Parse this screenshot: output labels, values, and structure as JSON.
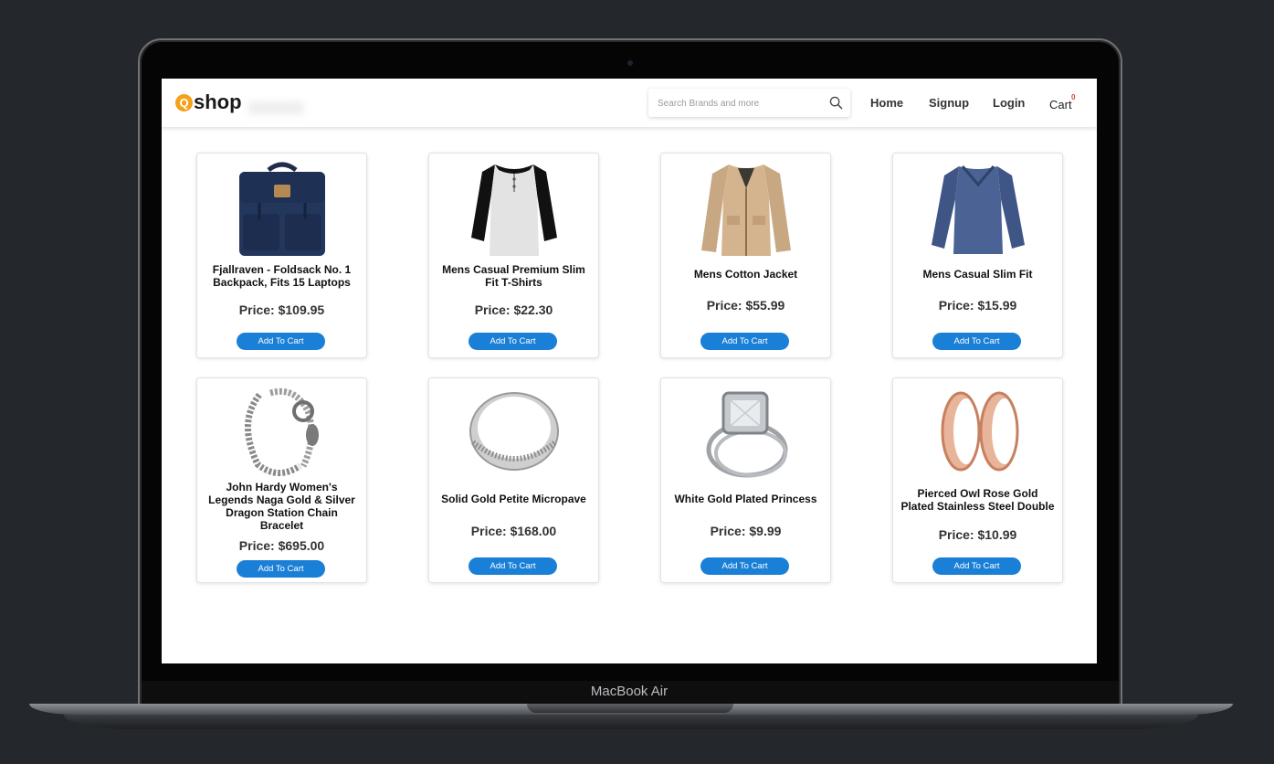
{
  "app": {
    "logo_letter": "Q",
    "logo_text": "shop"
  },
  "search": {
    "placeholder": "Search Brands and more"
  },
  "nav": {
    "home": "Home",
    "signup": "Signup",
    "login": "Login",
    "cart": "Cart",
    "cart_count": "0"
  },
  "device": {
    "label": "MacBook Air"
  },
  "products": [
    {
      "title": "Fjallraven - Foldsack No. 1 Backpack, Fits 15 Laptops",
      "price": "Price: $109.95",
      "button": "Add To Cart",
      "image": "backpack"
    },
    {
      "title": "Mens Casual Premium Slim Fit T-Shirts",
      "price": "Price: $22.30",
      "button": "Add To Cart",
      "image": "raglan-shirt"
    },
    {
      "title": "Mens Cotton Jacket",
      "price": "Price: $55.99",
      "button": "Add To Cart",
      "image": "jacket"
    },
    {
      "title": "Mens Casual Slim Fit",
      "price": "Price: $15.99",
      "button": "Add To Cart",
      "image": "long-sleeve-shirt"
    },
    {
      "title": "John Hardy Women's Legends Naga Gold & Silver Dragon Station Chain Bracelet",
      "price": "Price: $695.00",
      "button": "Add To Cart",
      "image": "bracelet"
    },
    {
      "title": "Solid Gold Petite Micropave",
      "price": "Price: $168.00",
      "button": "Add To Cart",
      "image": "ring"
    },
    {
      "title": "White Gold Plated Princess",
      "price": "Price: $9.99",
      "button": "Add To Cart",
      "image": "diamond-ring"
    },
    {
      "title": "Pierced Owl Rose Gold Plated Stainless Steel Double",
      "price": "Price: $10.99",
      "button": "Add To Cart",
      "image": "rose-gold-tunnels"
    }
  ],
  "colors": {
    "accent": "#1a7fd6",
    "logo": "#f4a11b",
    "cart_badge": "#e53935",
    "background": "#24282c"
  }
}
